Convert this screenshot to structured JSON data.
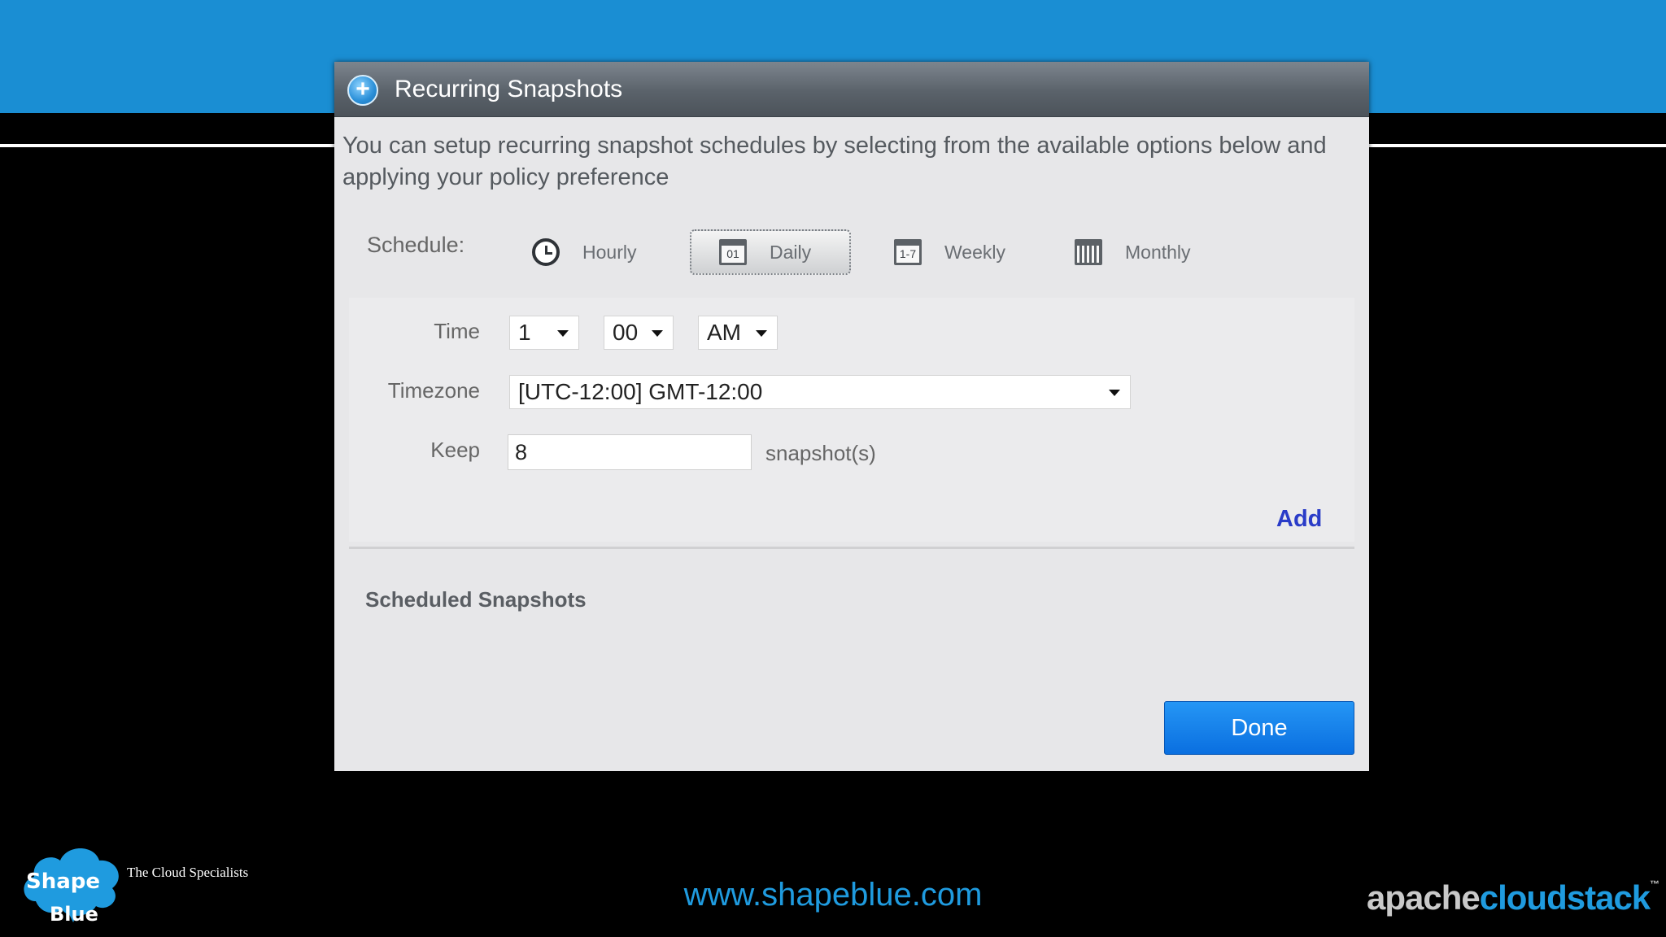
{
  "dialog": {
    "title": "Recurring Snapshots",
    "intro": "You can setup recurring snapshot schedules by selecting from the available options below and applying your policy preference",
    "schedule_label": "Schedule:",
    "tabs": [
      {
        "label": "Hourly",
        "icon": "clock-icon",
        "selected": false
      },
      {
        "label": "Daily",
        "icon": "calendar-day-icon",
        "icon_text": "01",
        "selected": true
      },
      {
        "label": "Weekly",
        "icon": "calendar-week-icon",
        "icon_text": "1-7",
        "selected": false
      },
      {
        "label": "Monthly",
        "icon": "calendar-month-icon",
        "selected": false
      }
    ],
    "form": {
      "time_label": "Time",
      "hour": "1",
      "minute": "00",
      "meridiem": "AM",
      "timezone_label": "Timezone",
      "timezone": "[UTC-12:00] GMT-12:00",
      "keep_label": "Keep",
      "keep_value": "8",
      "keep_suffix": "snapshot(s)",
      "add_label": "Add"
    },
    "scheduled_heading": "Scheduled Snapshots",
    "done_label": "Done"
  },
  "footer": {
    "logo_word1": "Shape",
    "logo_word2": "Blue",
    "tagline": "The Cloud Specialists",
    "url": "www.shapeblue.com",
    "brand_part1": "apache",
    "brand_part2": "cloudstack",
    "brand_tm": "™"
  },
  "colors": {
    "top_band": "#1a8ed3",
    "accent_blue": "#1f9bdf",
    "done_button": "#0a6fe0",
    "add_link": "#2a3cc8"
  }
}
